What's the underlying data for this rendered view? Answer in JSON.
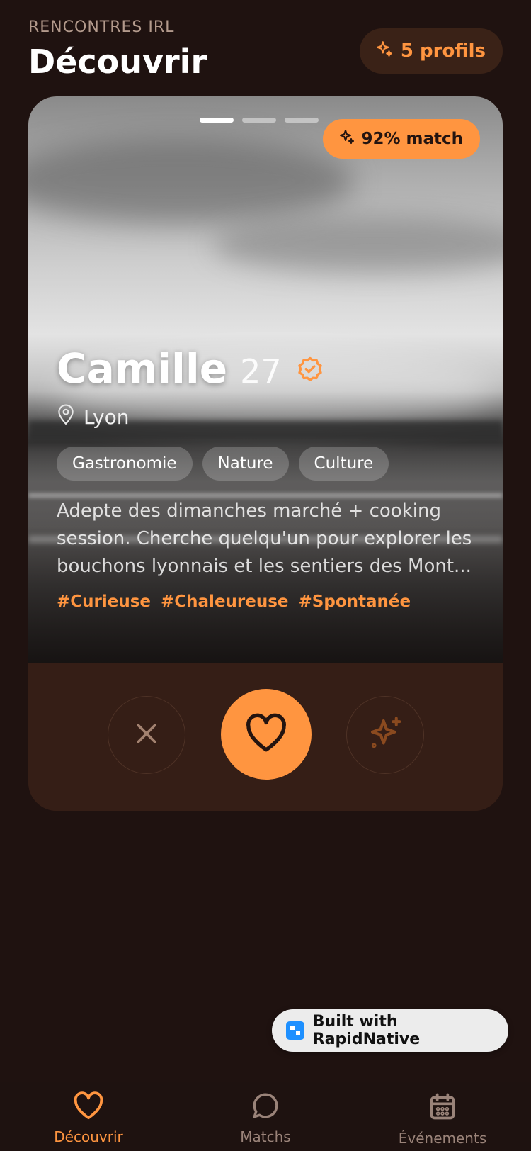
{
  "header": {
    "eyebrow": "RENCONTRES IRL",
    "title": "Découvrir",
    "profiles_badge": "5 profils"
  },
  "card": {
    "photo_pages": 3,
    "active_photo": 1,
    "match_badge": "92% match",
    "name": "Camille",
    "age": "27",
    "verified": true,
    "location": "Lyon",
    "interests": [
      "Gastronomie",
      "Nature",
      "Culture"
    ],
    "bio": "Adepte des dimanches marché + cooking session. Cherche quelqu'un pour explorer les bouchons lyonnais et les sentiers des Mont...",
    "hashtags": [
      "#Curieuse",
      "#Chaleureuse",
      "#Spontanée"
    ]
  },
  "actions": {
    "pass_icon": "close-icon",
    "like_icon": "heart-icon",
    "super_icon": "sparkles-icon"
  },
  "built_with": "Built with RapidNative",
  "tabbar": {
    "tabs": [
      {
        "label": "Découvrir",
        "icon": "heart-icon",
        "active": true
      },
      {
        "label": "Matchs",
        "icon": "chat-bubble-icon",
        "active": false
      },
      {
        "label": "Événements",
        "icon": "calendar-icon",
        "active": false
      }
    ]
  },
  "colors": {
    "background": "#1f1210",
    "accent": "#ff9540",
    "card_footer": "#351e16",
    "muted": "#9a8379"
  }
}
